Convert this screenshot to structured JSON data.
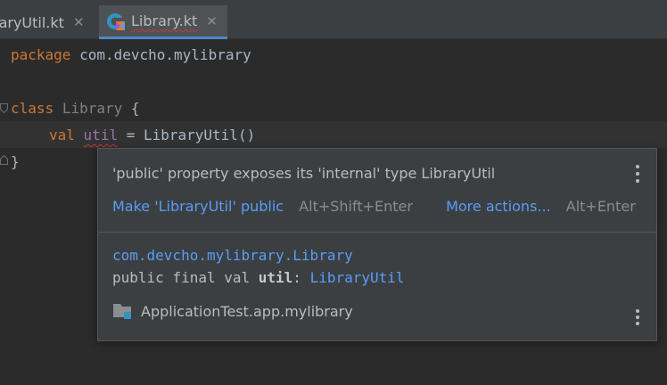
{
  "tabs": [
    {
      "label": "raryUtil.kt",
      "close": "✕"
    },
    {
      "label": "Library.kt",
      "close": "✕",
      "active": true
    }
  ],
  "code": {
    "line1": {
      "keyword": "package",
      "text": " com.devcho.mylibrary"
    },
    "line3": {
      "keyword": "class",
      "name": "Library",
      "brace": " {"
    },
    "line4": {
      "keyword": "val",
      "property": "util",
      "rest": " = LibraryUtil()"
    },
    "line5": {
      "brace": "}"
    }
  },
  "popup": {
    "message": "'public' property exposes its 'internal' type LibraryUtil",
    "quick_fix": {
      "label": "Make 'LibraryUtil' public",
      "shortcut": "Alt+Shift+Enter"
    },
    "more_actions": {
      "label": "More actions...",
      "shortcut": "Alt+Enter"
    },
    "doc": {
      "fqname": "com.devcho.mylibrary.Library",
      "modifiers": "public final val ",
      "name": "util",
      "separator": ": ",
      "type": "LibraryUtil"
    },
    "module": "ApplicationTest.app.mylibrary"
  },
  "colors": {
    "background": "#2b2b2b",
    "keyword": "#cc7832",
    "link": "#589df6",
    "property": "#9876aa",
    "error_underline": "#bc3f3c",
    "tab_accent": "#4a88c7"
  },
  "icons": {
    "kotlin_file": "kotlin-class-file-icon",
    "close": "close-icon",
    "more": "kebab-menu-icon",
    "module": "module-folder-icon"
  }
}
